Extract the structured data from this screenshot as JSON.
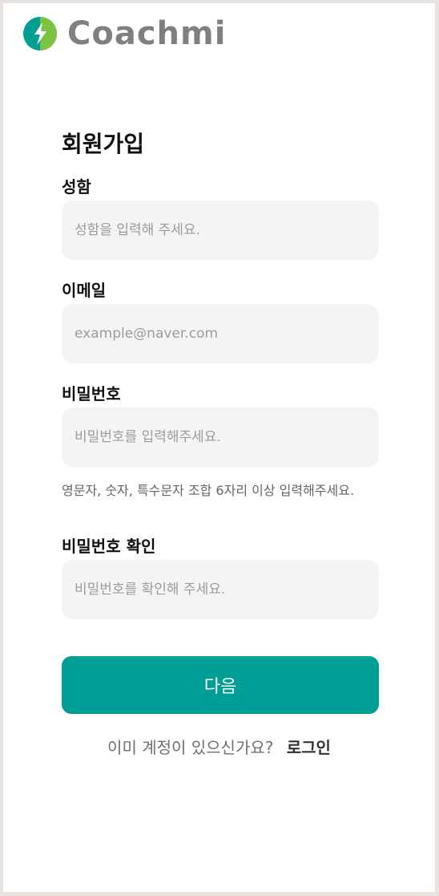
{
  "brand": {
    "name": "Coachmi",
    "colors": {
      "teal": "#009f96",
      "green": "#7ec242"
    }
  },
  "form": {
    "title": "회원가입",
    "name": {
      "label": "성함",
      "placeholder": "성함을 입력해 주세요."
    },
    "email": {
      "label": "이메일",
      "placeholder": "example@naver.com"
    },
    "password": {
      "label": "비밀번호",
      "placeholder": "비밀번호를 입력해주세요.",
      "hint": "영문자, 숫자, 특수문자 조합 6자리 이상 입력해주세요."
    },
    "password_confirm": {
      "label": "비밀번호 확인",
      "placeholder": "비밀번호를 확인해 주세요."
    },
    "next_label": "다음"
  },
  "footer": {
    "question": "이미 계정이 있으신가요?",
    "login_label": "로그인"
  }
}
